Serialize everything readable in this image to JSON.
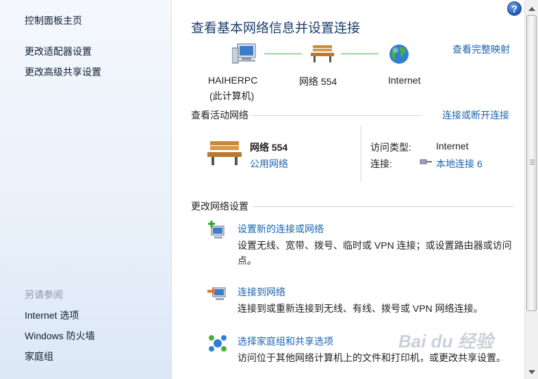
{
  "left_pane": {
    "items": [
      {
        "label": "控制面板主页"
      },
      {
        "label": "更改适配器设置"
      },
      {
        "label": "更改高级共享设置"
      }
    ],
    "see_also_heading": "另请参阅",
    "see_also": [
      {
        "label": "Internet 选项"
      },
      {
        "label": "Windows 防火墙"
      },
      {
        "label": "家庭组"
      }
    ]
  },
  "help_label": "?",
  "main": {
    "title": "查看基本网络信息并设置连接",
    "full_map_link": "查看完整映射",
    "map": {
      "computer_name": "HAIHERPC",
      "computer_sub": "(此计算机)",
      "network_name": "网络  554",
      "internet": "Internet"
    },
    "active": {
      "heading": "查看活动网络",
      "connect_link": "连接或断开连接",
      "network_name": "网络  554",
      "network_type": "公用网络",
      "access_type_label": "访问类型:",
      "access_type_value": "Internet",
      "connection_label": "连接:",
      "connection_value": "本地连接 6"
    },
    "change": {
      "heading": "更改网络设置",
      "tasks": [
        {
          "title": "设置新的连接或网络",
          "desc": "设置无线、宽带、拨号、临时或 VPN 连接；或设置路由器或访问点。"
        },
        {
          "title": "连接到网络",
          "desc": "连接到或重新连接到无线、有线、拨号或 VPN 网络连接。"
        },
        {
          "title": "选择家庭组和共享选项",
          "desc": "访问位于其他网络计算机上的文件和打印机，或更改共享设置。"
        }
      ]
    }
  },
  "watermark": "Bai du 经验",
  "colors": {
    "link": "#1b64b1",
    "title": "#1a3e6e",
    "left_bg": "#eaf1fa"
  }
}
